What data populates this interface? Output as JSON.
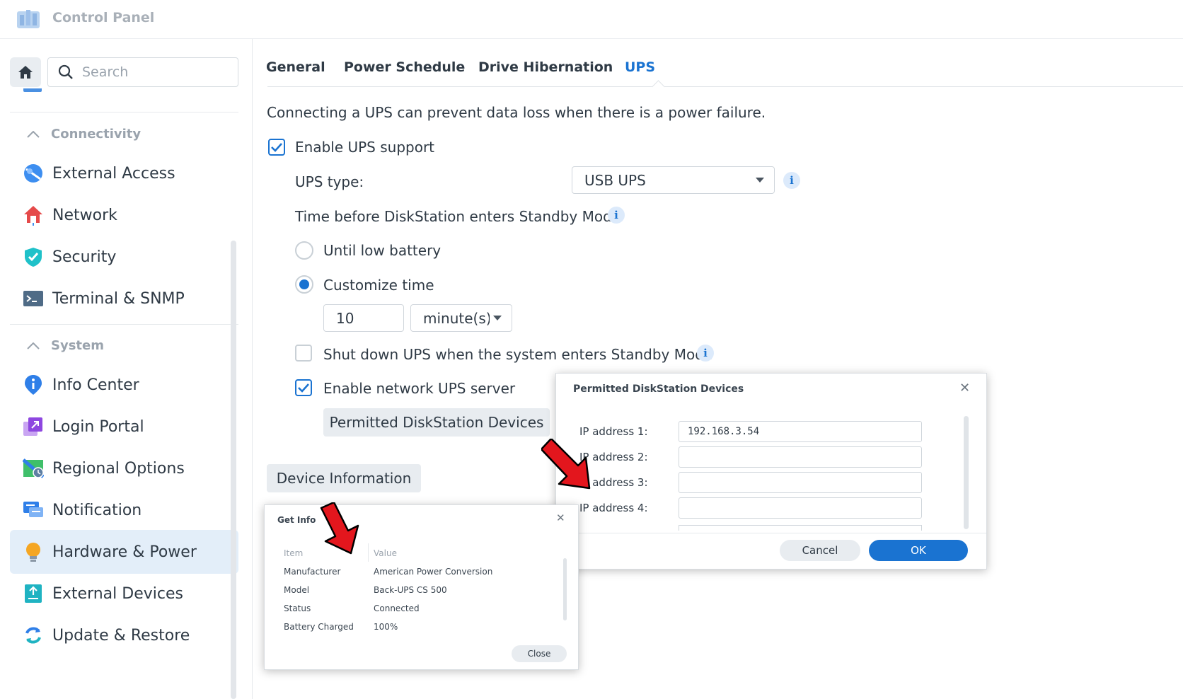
{
  "app": {
    "title": "Control Panel"
  },
  "sidebar": {
    "search_placeholder": "Search",
    "sections": [
      {
        "label": "Connectivity",
        "items": [
          {
            "label": "External Access",
            "icon": "external-access-icon"
          },
          {
            "label": "Network",
            "icon": "network-house-icon"
          },
          {
            "label": "Security",
            "icon": "shield-icon"
          },
          {
            "label": "Terminal & SNMP",
            "icon": "terminal-icon"
          }
        ]
      },
      {
        "label": "System",
        "items": [
          {
            "label": "Info Center",
            "icon": "info-pin-icon"
          },
          {
            "label": "Login Portal",
            "icon": "login-portal-icon"
          },
          {
            "label": "Regional Options",
            "icon": "regional-options-icon"
          },
          {
            "label": "Notification",
            "icon": "notification-icon"
          },
          {
            "label": "Hardware & Power",
            "icon": "lightbulb-icon",
            "active": true
          },
          {
            "label": "External Devices",
            "icon": "external-devices-icon"
          },
          {
            "label": "Update & Restore",
            "icon": "update-restore-icon"
          }
        ]
      }
    ]
  },
  "tabs": [
    {
      "label": "General"
    },
    {
      "label": "Power Schedule"
    },
    {
      "label": "Drive Hibernation"
    },
    {
      "label": "UPS",
      "active": true
    }
  ],
  "ups": {
    "intro": "Connecting a UPS can prevent data loss when there is a power failure.",
    "enable_label": "Enable UPS support",
    "enable_checked": true,
    "type_label": "UPS type:",
    "type_value": "USB UPS",
    "standby_label": "Time before DiskStation enters Standby Mode",
    "option_low_battery": "Until low battery",
    "option_customize": "Customize time",
    "selected_option": "Customize time",
    "time_value": "10",
    "time_unit": "minute(s)",
    "shutdown_label": "Shut down UPS when the system enters Standby Mode",
    "shutdown_checked": false,
    "network_server_label": "Enable network UPS server",
    "network_server_checked": true,
    "permitted_button": "Permitted DiskStation Devices",
    "device_info_button": "Device Information"
  },
  "permitted_dialog": {
    "title": "Permitted DiskStation Devices",
    "fields": [
      {
        "label": "IP address 1:",
        "value": "192.168.3.54"
      },
      {
        "label": "IP address 2:",
        "value": ""
      },
      {
        "label": "IP address 3:",
        "value": ""
      },
      {
        "label": "IP address 4:",
        "value": ""
      }
    ],
    "cancel": "Cancel",
    "ok": "OK"
  },
  "get_info_dialog": {
    "title": "Get Info",
    "columns": [
      "Item",
      "Value"
    ],
    "rows": [
      [
        "Manufacturer",
        "American Power Conversion"
      ],
      [
        "Model",
        "Back-UPS CS 500"
      ],
      [
        "Status",
        "Connected"
      ],
      [
        "Battery Charged",
        "100%"
      ]
    ],
    "close": "Close"
  },
  "colors": {
    "accent": "#1a73d1",
    "annotation_arrow": "#e3161d"
  }
}
